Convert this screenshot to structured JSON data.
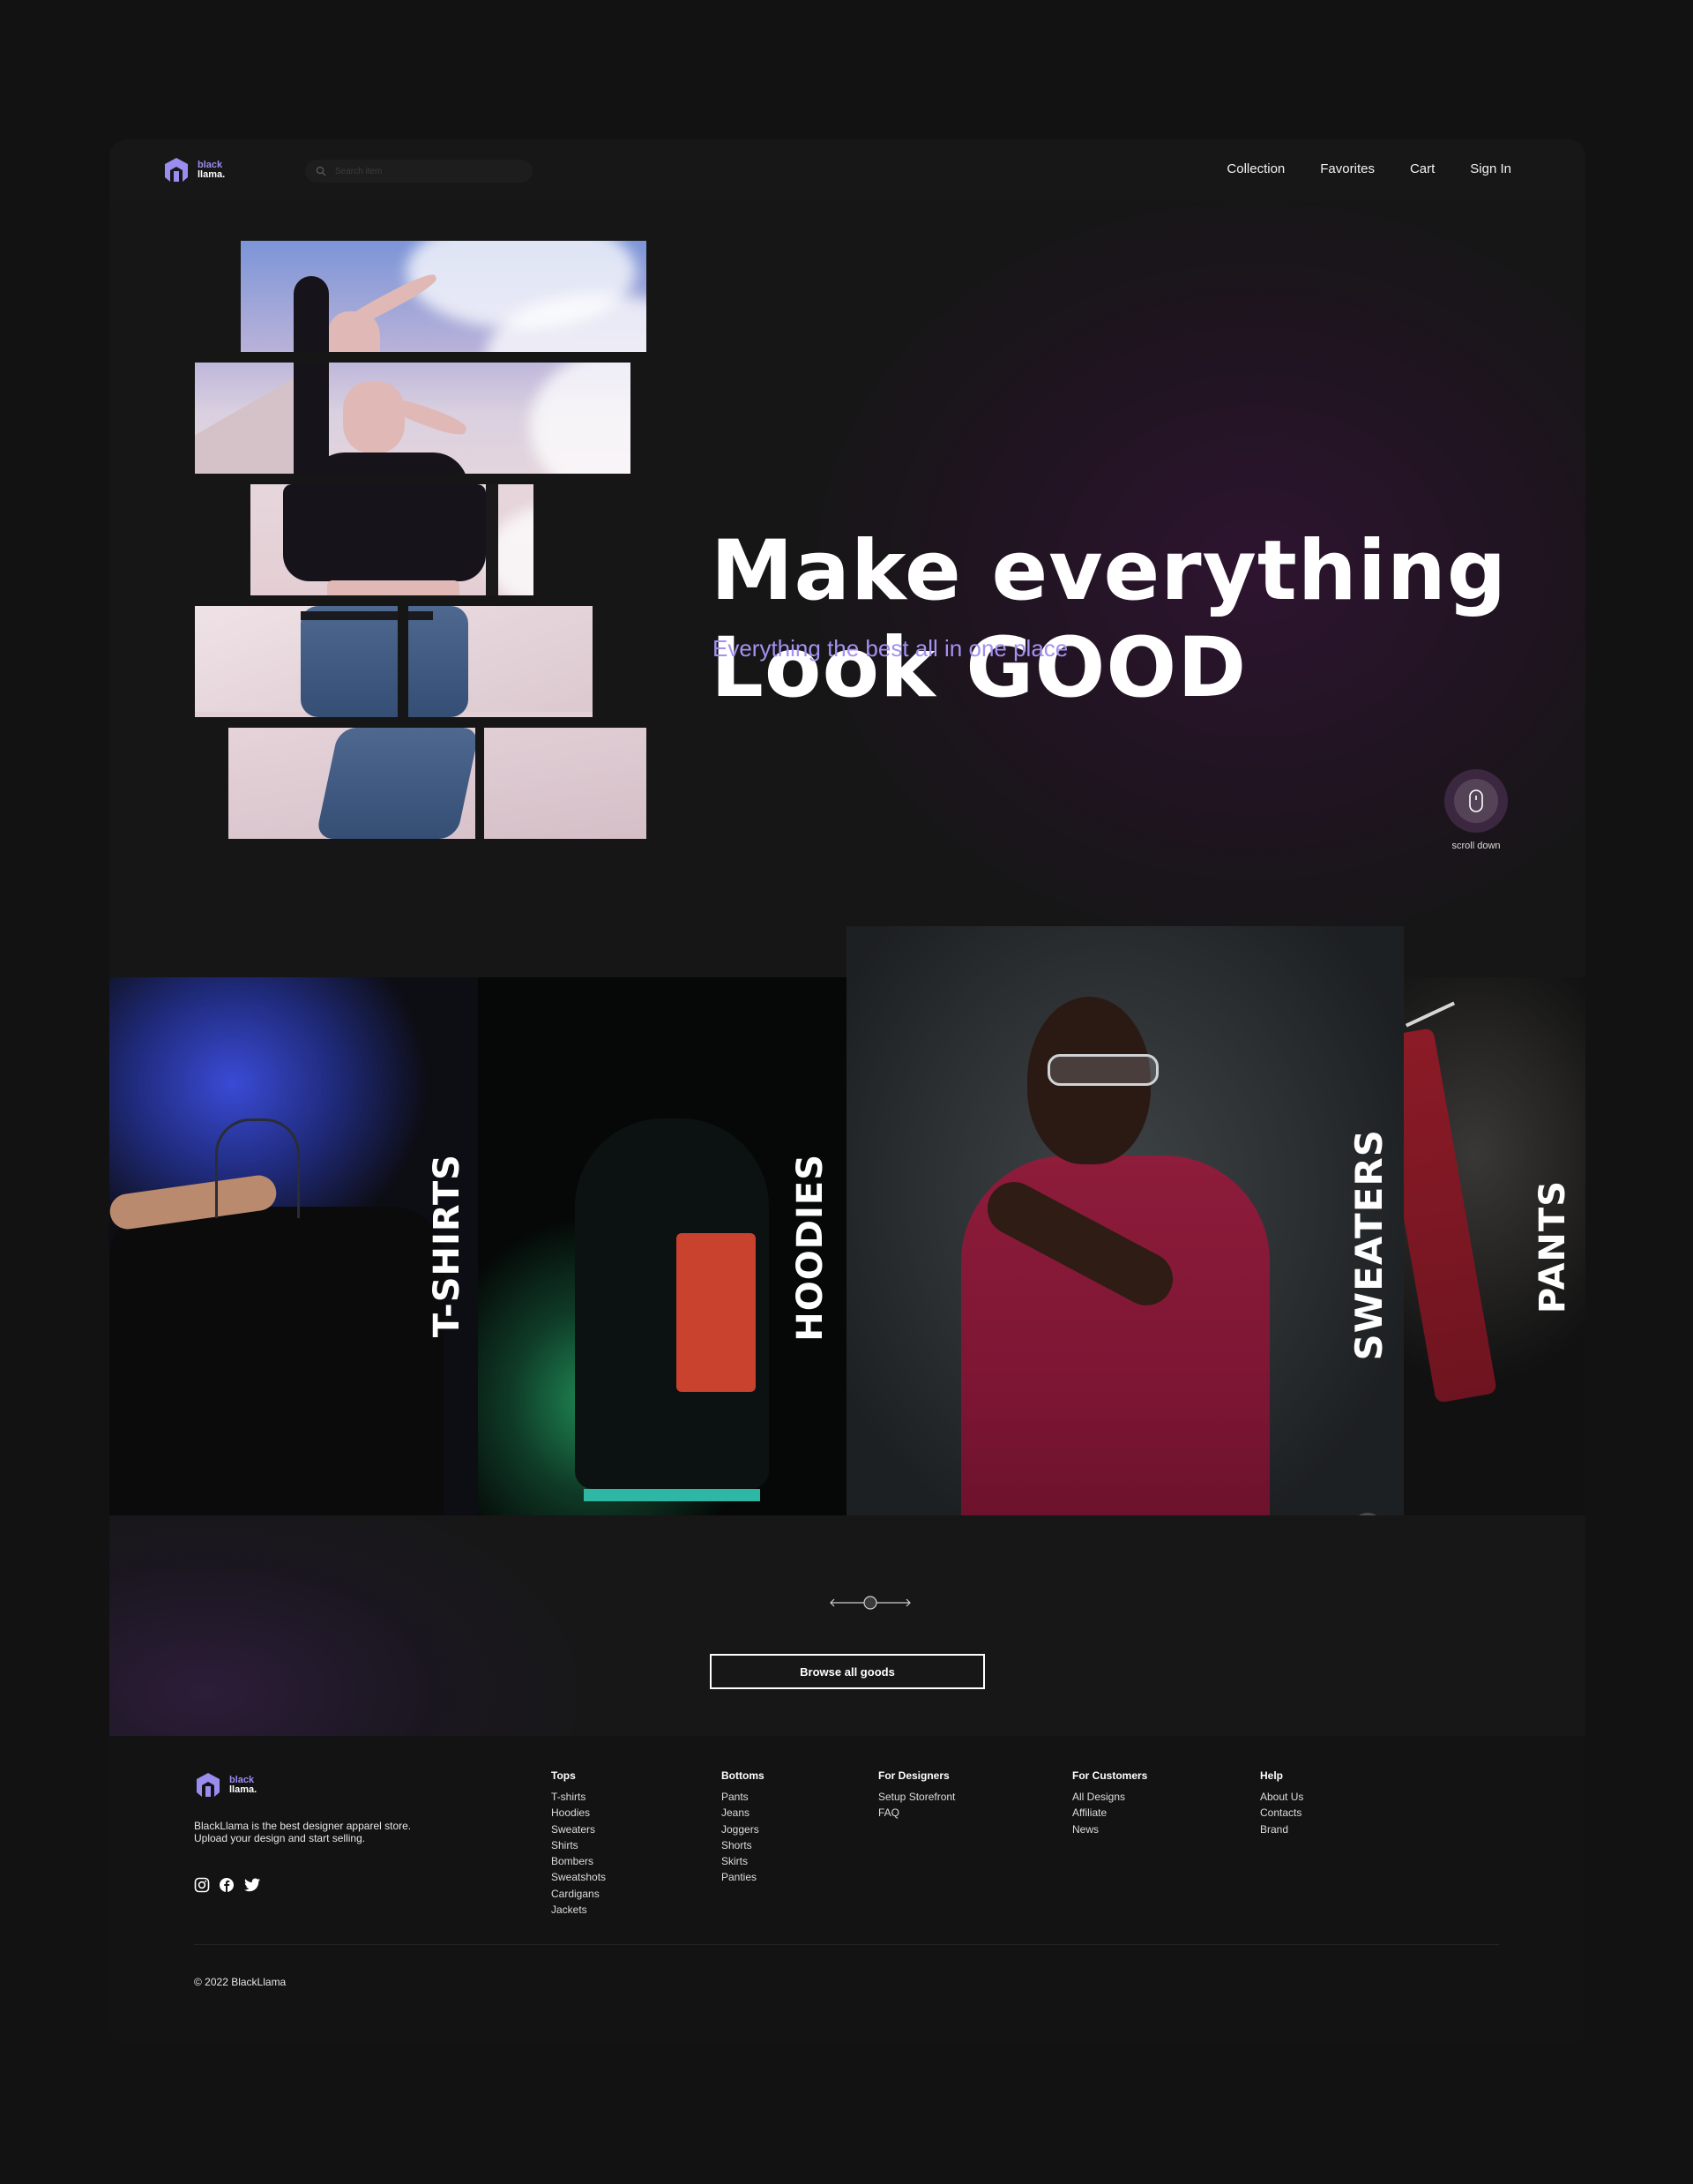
{
  "brand": {
    "line1": "black",
    "line2": "llama."
  },
  "search": {
    "placeholder": "Search item"
  },
  "nav": [
    "Collection",
    "Favorites",
    "Cart",
    "Sign In"
  ],
  "hero": {
    "title_line1": "Make everything",
    "title_line2": "Look GOOD",
    "subtitle": "Everything the best all in one place",
    "scroll_label": "scroll down"
  },
  "categories": [
    "T-SHIRTS",
    "HOODIES",
    "SWEATERS",
    "PANTS"
  ],
  "browse": {
    "label": "Browse all goods"
  },
  "footer": {
    "description": "BlackLlama is the best designer apparel store. Upload your design and start selling.",
    "columns": [
      {
        "title": "Tops",
        "links": [
          "T-shirts",
          "Hoodies",
          "Sweaters",
          "Shirts",
          "Bombers",
          "Sweatshots",
          "Cardigans",
          "Jackets"
        ]
      },
      {
        "title": "Bottoms",
        "links": [
          "Pants",
          "Jeans",
          "Joggers",
          "Shorts",
          "Skirts",
          "Panties"
        ]
      },
      {
        "title": "For Designers",
        "links": [
          "Setup Storefront",
          "FAQ"
        ]
      },
      {
        "title": "For Customers",
        "links": [
          "All Designs",
          "Affiliate",
          "News"
        ]
      },
      {
        "title": "Help",
        "links": [
          "About Us",
          "Contacts",
          "Brand"
        ]
      }
    ],
    "social": [
      "instagram-icon",
      "facebook-icon",
      "twitter-icon"
    ],
    "copyright": "© 2022 BlackLlama"
  },
  "colors": {
    "accent": "#9b8cf0",
    "subtitle": "#a491f0",
    "background": "#121212"
  }
}
